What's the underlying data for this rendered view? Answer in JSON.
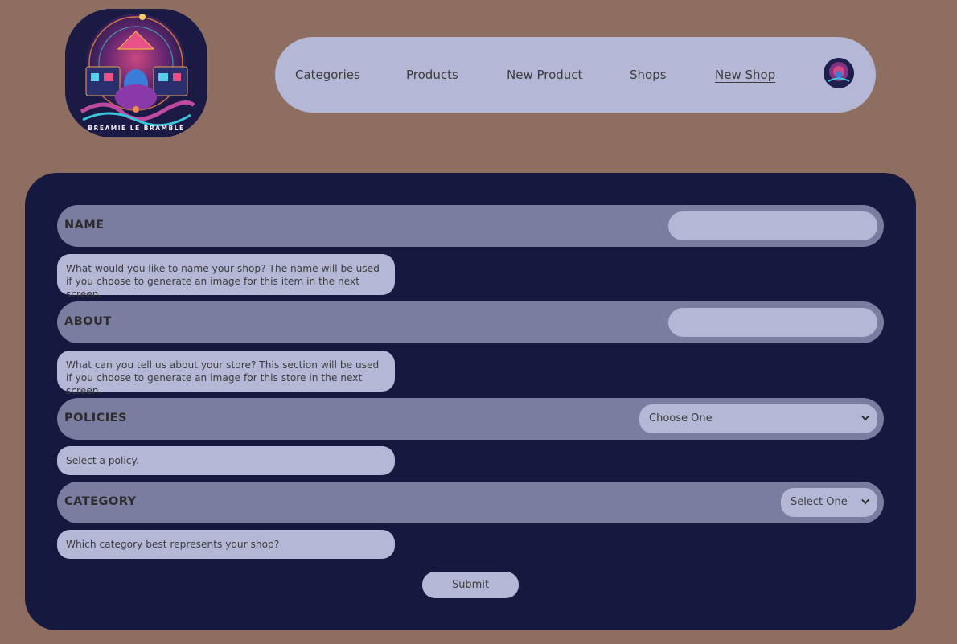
{
  "brand": {
    "logo_text": "BREAMIE LE BRAMBLE"
  },
  "nav": {
    "items": [
      {
        "label": "Categories"
      },
      {
        "label": "Products"
      },
      {
        "label": "New Product"
      },
      {
        "label": "Shops"
      },
      {
        "label": "New Shop",
        "active": true
      }
    ]
  },
  "form": {
    "name": {
      "label": "NAME",
      "value": "",
      "help": "What would you like to name your shop? The name will be used if you choose to generate an image for this item in the next screen."
    },
    "about": {
      "label": "ABOUT",
      "value": "",
      "help": "What can you tell us about your store? This section will be used if you choose to generate an image for this store in the next screen."
    },
    "policies": {
      "label": "POLICIES",
      "selected": "Choose One",
      "help": "Select a policy."
    },
    "category": {
      "label": "CATEGORY",
      "selected": "Select One",
      "help": "Which category best represents your shop?"
    },
    "submit_label": "Submit"
  },
  "colors": {
    "page_bg": "#8e6e61",
    "panel_bg": "#15183f",
    "row_bg": "#7a7ca0",
    "field_bg": "#b4b8d6"
  }
}
